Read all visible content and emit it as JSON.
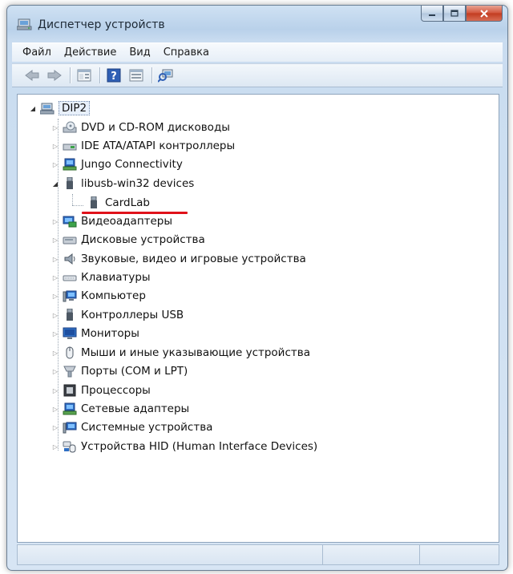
{
  "window": {
    "title": "Диспетчер устройств"
  },
  "menu": [
    "Файл",
    "Действие",
    "Вид",
    "Справка"
  ],
  "toolbar": {
    "icons": [
      "back-icon",
      "forward-icon",
      "properties-icon",
      "help-icon",
      "view-icon",
      "scan-hardware-icon"
    ]
  },
  "tree": {
    "root": "DIP2",
    "items": [
      {
        "label": "DVD и CD-ROM дисководы",
        "icon": "dvd-drive-icon",
        "expanded": false
      },
      {
        "label": "IDE ATA/ATAPI контроллеры",
        "icon": "ide-controller-icon",
        "expanded": false
      },
      {
        "label": "Jungo Connectivity",
        "icon": "jungo-icon",
        "expanded": false
      },
      {
        "label": "libusb-win32 devices",
        "icon": "usb-plug-icon",
        "expanded": true,
        "children": [
          "CardLab"
        ]
      },
      {
        "label": "Видеоадаптеры",
        "icon": "display-adapter-icon",
        "expanded": false
      },
      {
        "label": "Дисковые устройства",
        "icon": "disk-drive-icon",
        "expanded": false
      },
      {
        "label": "Звуковые, видео и игровые устройства",
        "icon": "speaker-icon",
        "expanded": false
      },
      {
        "label": "Клавиатуры",
        "icon": "keyboard-icon",
        "expanded": false
      },
      {
        "label": "Компьютер",
        "icon": "computer-icon",
        "expanded": false
      },
      {
        "label": "Контроллеры USB",
        "icon": "usb-plug-icon",
        "expanded": false
      },
      {
        "label": "Мониторы",
        "icon": "monitor-icon",
        "expanded": false
      },
      {
        "label": "Мыши и иные указывающие устройства",
        "icon": "mouse-icon",
        "expanded": false
      },
      {
        "label": "Порты (COM и LPT)",
        "icon": "port-icon",
        "expanded": false
      },
      {
        "label": "Процессоры",
        "icon": "processor-icon",
        "expanded": false
      },
      {
        "label": "Сетевые адаптеры",
        "icon": "network-adapter-icon",
        "expanded": false
      },
      {
        "label": "Системные устройства",
        "icon": "system-device-icon",
        "expanded": false
      },
      {
        "label": "Устройства HID (Human Interface Devices)",
        "icon": "hid-icon",
        "expanded": false
      }
    ]
  },
  "colors": {
    "highlight_underline": "#e0121a",
    "titlebar": "#b9d1ea"
  }
}
